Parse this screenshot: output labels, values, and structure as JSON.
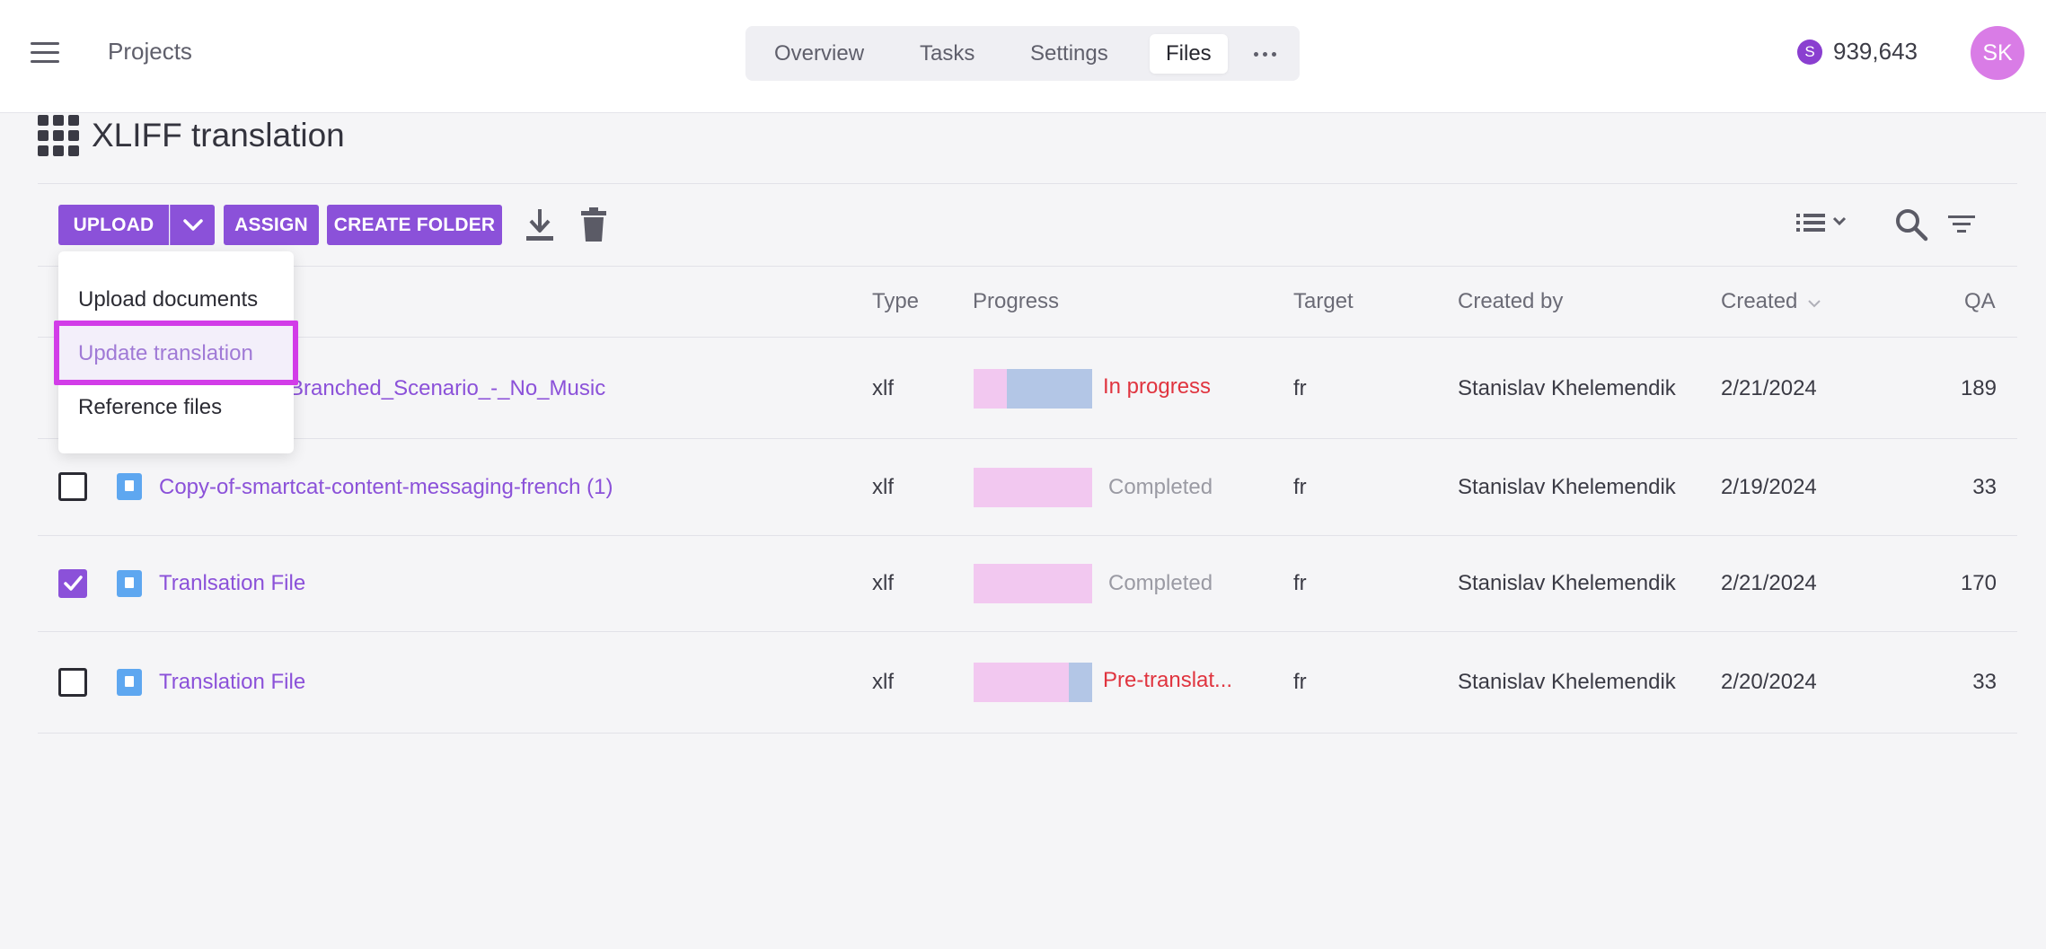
{
  "topbar": {
    "projects_label": "Projects",
    "tabs": [
      {
        "label": "Overview"
      },
      {
        "label": "Tasks"
      },
      {
        "label": "Settings"
      },
      {
        "label": "Files"
      }
    ],
    "active_tab": "Files",
    "balance": "939,643",
    "coin_symbol": "S",
    "avatar_initials": "SK"
  },
  "page": {
    "title": "XLIFF translation"
  },
  "toolbar": {
    "upload_label": "UPLOAD",
    "assign_label": "ASSIGN",
    "create_folder_label": "CREATE FOLDER",
    "icons": [
      "download-icon",
      "trash-icon",
      "list-view-icon",
      "search-icon",
      "filter-icon"
    ]
  },
  "upload_menu": {
    "items": [
      {
        "label": "Upload documents"
      },
      {
        "label": "Update translation"
      },
      {
        "label": "Reference files"
      }
    ],
    "highlighted_item": "Update translation"
  },
  "table": {
    "headers": {
      "type": "Type",
      "progress": "Progress",
      "target": "Target",
      "created_by": "Created by",
      "created": "Created",
      "qa": "QA"
    },
    "sorted_column": "Created",
    "rows": [
      {
        "checked": false,
        "name": "Branched_Scenario_-_No_Music",
        "type": "xlf",
        "status": "In progress",
        "status_color": "#e0343f",
        "progress_pink_fraction": 0.2,
        "progress_blue_fraction": 0.8,
        "target": "fr",
        "created_by": "Stanislav Khelemendik",
        "created": "2/21/2024",
        "qa": "189"
      },
      {
        "checked": false,
        "name": "Copy-of-smartcat-content-messaging-french (1)",
        "type": "xlf",
        "status": "Completed",
        "status_color": "#9a9aa3",
        "progress_pink_fraction": 1.0,
        "progress_blue_fraction": 0.0,
        "target": "fr",
        "created_by": "Stanislav Khelemendik",
        "created": "2/19/2024",
        "qa": "33"
      },
      {
        "checked": true,
        "name": "Tranlsation File",
        "type": "xlf",
        "status": "Completed",
        "status_color": "#9a9aa3",
        "progress_pink_fraction": 1.0,
        "progress_blue_fraction": 0.0,
        "target": "fr",
        "created_by": "Stanislav Khelemendik",
        "created": "2/21/2024",
        "qa": "170"
      },
      {
        "checked": false,
        "name": "Translation File",
        "type": "xlf",
        "status": "Pre-translat...",
        "status_color": "#e0343f",
        "progress_pink_fraction": 0.8,
        "progress_blue_fraction": 0.2,
        "target": "fr",
        "created_by": "Stanislav Khelemendik",
        "created": "2/20/2024",
        "qa": "33"
      }
    ]
  },
  "colors": {
    "accent": "#8b51d9",
    "progress_pink": "#f2c8f0",
    "progress_blue": "#b3c6e6",
    "menu_highlight_border": "#d23ce8"
  }
}
